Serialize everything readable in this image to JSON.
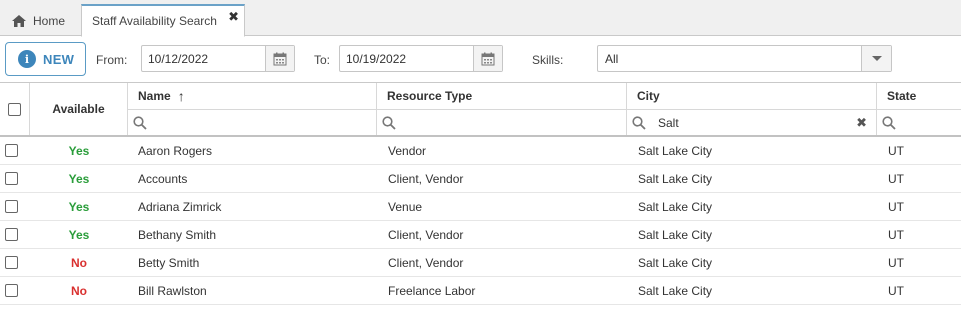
{
  "tabs": {
    "home_label": "Home",
    "active_label": "Staff Availability Search",
    "close_glyph": "✖"
  },
  "toolbar": {
    "new_label": "NEW",
    "from_label": "From:",
    "from_value": "10/12/2022",
    "to_label": "To:",
    "to_value": "10/19/2022",
    "skills_label": "Skills:",
    "skills_value": "All"
  },
  "grid": {
    "columns": {
      "available": "Available",
      "name": "Name",
      "resource_type": "Resource Type",
      "city": "City",
      "state": "State"
    },
    "sort_indicator": "↑",
    "filters": {
      "city_value": "Salt",
      "clear_glyph": "✖"
    },
    "rows": [
      {
        "available": "Yes",
        "name": "Aaron Rogers",
        "resource_type": "Vendor",
        "city": "Salt Lake City",
        "state": "UT"
      },
      {
        "available": "Yes",
        "name": "Accounts",
        "resource_type": "Client, Vendor",
        "city": "Salt Lake City",
        "state": "UT"
      },
      {
        "available": "Yes",
        "name": "Adriana Zimrick",
        "resource_type": "Venue",
        "city": "Salt Lake City",
        "state": "UT"
      },
      {
        "available": "Yes",
        "name": "Bethany Smith",
        "resource_type": "Client, Vendor",
        "city": "Salt Lake City",
        "state": "UT"
      },
      {
        "available": "No",
        "name": "Betty Smith",
        "resource_type": "Client, Vendor",
        "city": "Salt Lake City",
        "state": "UT"
      },
      {
        "available": "No",
        "name": "Bill Rawlston",
        "resource_type": "Freelance Labor",
        "city": "Salt Lake City",
        "state": "UT"
      }
    ]
  },
  "colors": {
    "yes": "#2a9d3a",
    "no": "#d9302f",
    "accent": "#3d86bb"
  },
  "icons": {
    "home": "home-icon",
    "calendar": "calendar-icon",
    "search": "search-icon",
    "info": "info-icon"
  }
}
